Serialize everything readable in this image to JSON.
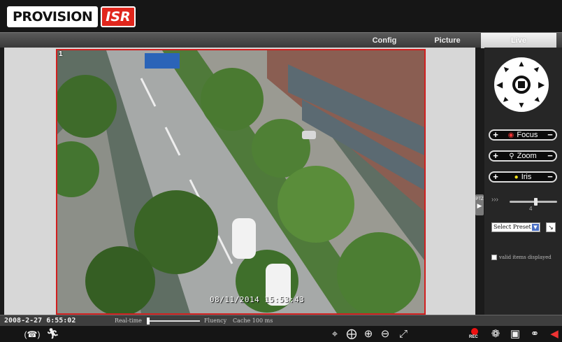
{
  "header": {
    "logo_word": "PROVISION",
    "logo_badge": "ISR"
  },
  "tabs": [
    {
      "label": "Config"
    },
    {
      "label": "Picture"
    },
    {
      "label": "Live",
      "active": true
    }
  ],
  "video": {
    "channel_number": "1",
    "osd_timestamp": "08/11/2014 15:53:43"
  },
  "ptz": {
    "toggle_label": "PTZ",
    "focus_label": "Focus",
    "zoom_label": "Zoom",
    "iris_label": "Iris",
    "plus": "+",
    "minus": "−",
    "speed_value": "4",
    "speed_fraction": 0.55,
    "preset_select": "Select Preset",
    "invalid_label": "valid items displayed"
  },
  "status": {
    "datetime": "2008-2-27 6:55:02",
    "realtime_label": "Real-time",
    "fluency_label": "Fluency",
    "cache_label": "Cache 100 ms",
    "latency_fraction": 0.0
  },
  "toolbar": {
    "left_icons": [
      "intercom-icon",
      "motion-icon"
    ],
    "center_icons": [
      "fit-window-icon",
      "ptz-move-icon",
      "zoom-in-icon",
      "zoom-out-icon",
      "fullscreen-icon"
    ],
    "right_icons": [
      "record-icon",
      "color-adjust-icon",
      "snapshot-icon",
      "microphone-icon",
      "speaker-icon"
    ],
    "rec_label": "REC"
  },
  "colors": {
    "accent_red": "#d21f1f",
    "panel_bg": "#262626",
    "tab_active": "#e6e6e6"
  }
}
